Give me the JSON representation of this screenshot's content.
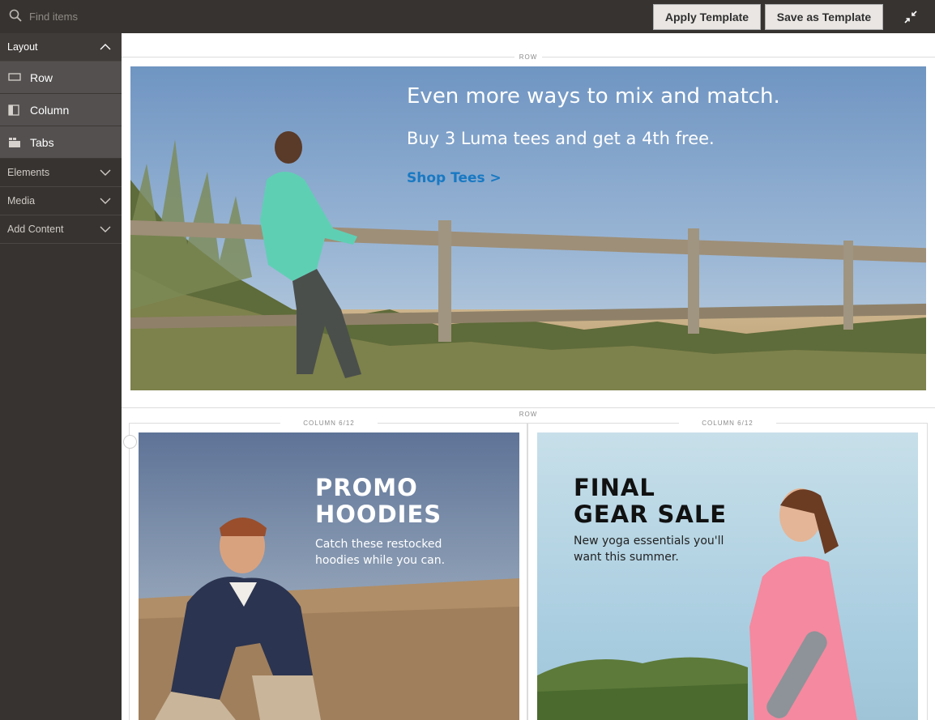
{
  "search": {
    "placeholder": "Find items"
  },
  "toolbar": {
    "apply_label": "Apply Template",
    "save_label": "Save as Template"
  },
  "sidebar": {
    "layout_label": "Layout",
    "layout_items": [
      {
        "label": "Row",
        "icon": "row-icon"
      },
      {
        "label": "Column",
        "icon": "column-icon"
      },
      {
        "label": "Tabs",
        "icon": "tabs-icon"
      }
    ],
    "sections": [
      {
        "label": "Elements"
      },
      {
        "label": "Media"
      },
      {
        "label": "Add Content"
      }
    ]
  },
  "stage": {
    "row1_label": "ROW",
    "row2_label": "ROW",
    "col_left_label": "COLUMN 6/12",
    "col_right_label": "COLUMN 6/12",
    "banner": {
      "title": "Even more ways to mix and match.",
      "subtitle": "Buy 3 Luma tees and get a 4th free.",
      "link": "Shop Tees >"
    },
    "promo_left": {
      "heading_line1": "PROMO",
      "heading_line2": "HOODIES",
      "text_line1": "Catch these restocked",
      "text_line2": "hoodies while you can."
    },
    "promo_right": {
      "heading_line1": "FINAL",
      "heading_line2": "GEAR SALE",
      "text_line1": "New yoga essentials you'll",
      "text_line2": "want this summer."
    }
  },
  "colors": {
    "chrome_dark": "#373330",
    "sidebar_item": "#545050",
    "link_blue": "#1979c3"
  }
}
